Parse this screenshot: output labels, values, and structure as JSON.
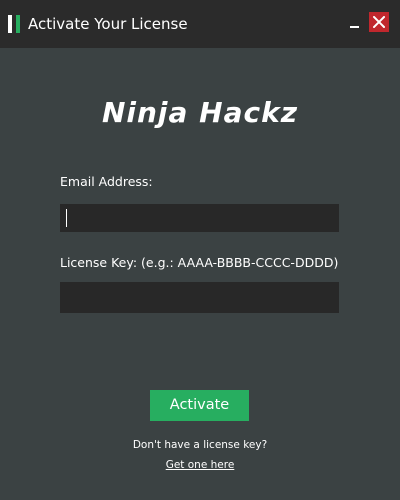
{
  "window": {
    "title": "Activate Your License"
  },
  "brand": {
    "title": "Ninja Hackz"
  },
  "form": {
    "email_label": "Email Address:",
    "email_value": "",
    "license_label": "License Key: (e.g.: AAAA-BBBB-CCCC-DDDD)",
    "license_value": "",
    "activate_label": "Activate"
  },
  "footer": {
    "no_key_text": "Don't have a license key?",
    "get_one_link": "Get one here"
  },
  "colors": {
    "background": "#3b4243",
    "titlebar": "#2b2b2b",
    "input_bg": "#282828",
    "accent_green": "#27ae60",
    "close_red": "#c0272d"
  },
  "icons": {
    "app": "app-logo-icon",
    "minimize": "minimize-icon",
    "close": "close-icon"
  }
}
